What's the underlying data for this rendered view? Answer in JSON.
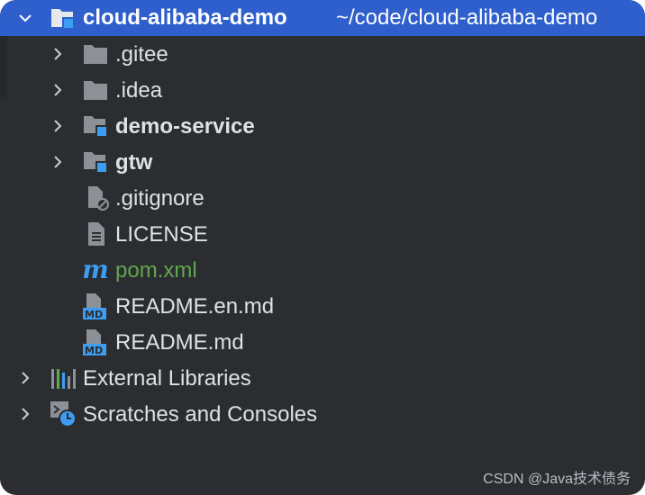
{
  "tree": {
    "root": {
      "name": "cloud-alibaba-demo",
      "path": "~/code/cloud-alibaba-demo",
      "expanded": true
    },
    "items": [
      {
        "label": ".gitee",
        "kind": "folder",
        "icon": "folder-icon"
      },
      {
        "label": ".idea",
        "kind": "folder",
        "icon": "folder-icon"
      },
      {
        "label": "demo-service",
        "kind": "module",
        "icon": "module-folder-icon"
      },
      {
        "label": "gtw",
        "kind": "module",
        "icon": "module-folder-icon"
      },
      {
        "label": ".gitignore",
        "kind": "file",
        "icon": "ignored-file-icon"
      },
      {
        "label": "LICENSE",
        "kind": "file",
        "icon": "text-file-icon"
      },
      {
        "label": "pom.xml",
        "kind": "file",
        "icon": "maven-icon"
      },
      {
        "label": "README.en.md",
        "kind": "file",
        "icon": "markdown-file-icon"
      },
      {
        "label": "README.md",
        "kind": "file",
        "icon": "markdown-file-icon"
      }
    ],
    "extras": [
      {
        "label": "External Libraries",
        "icon": "libraries-icon"
      },
      {
        "label": "Scratches and Consoles",
        "icon": "scratches-icon"
      }
    ]
  },
  "watermark": "CSDN @Java技术债务",
  "colors": {
    "background": "#2b2d30",
    "selection": "#2e5fcc",
    "text": "#dfe1e5",
    "maven_text": "#5fa850",
    "module_badge": "#3d9df2",
    "folder_icon": "#8c9097"
  }
}
